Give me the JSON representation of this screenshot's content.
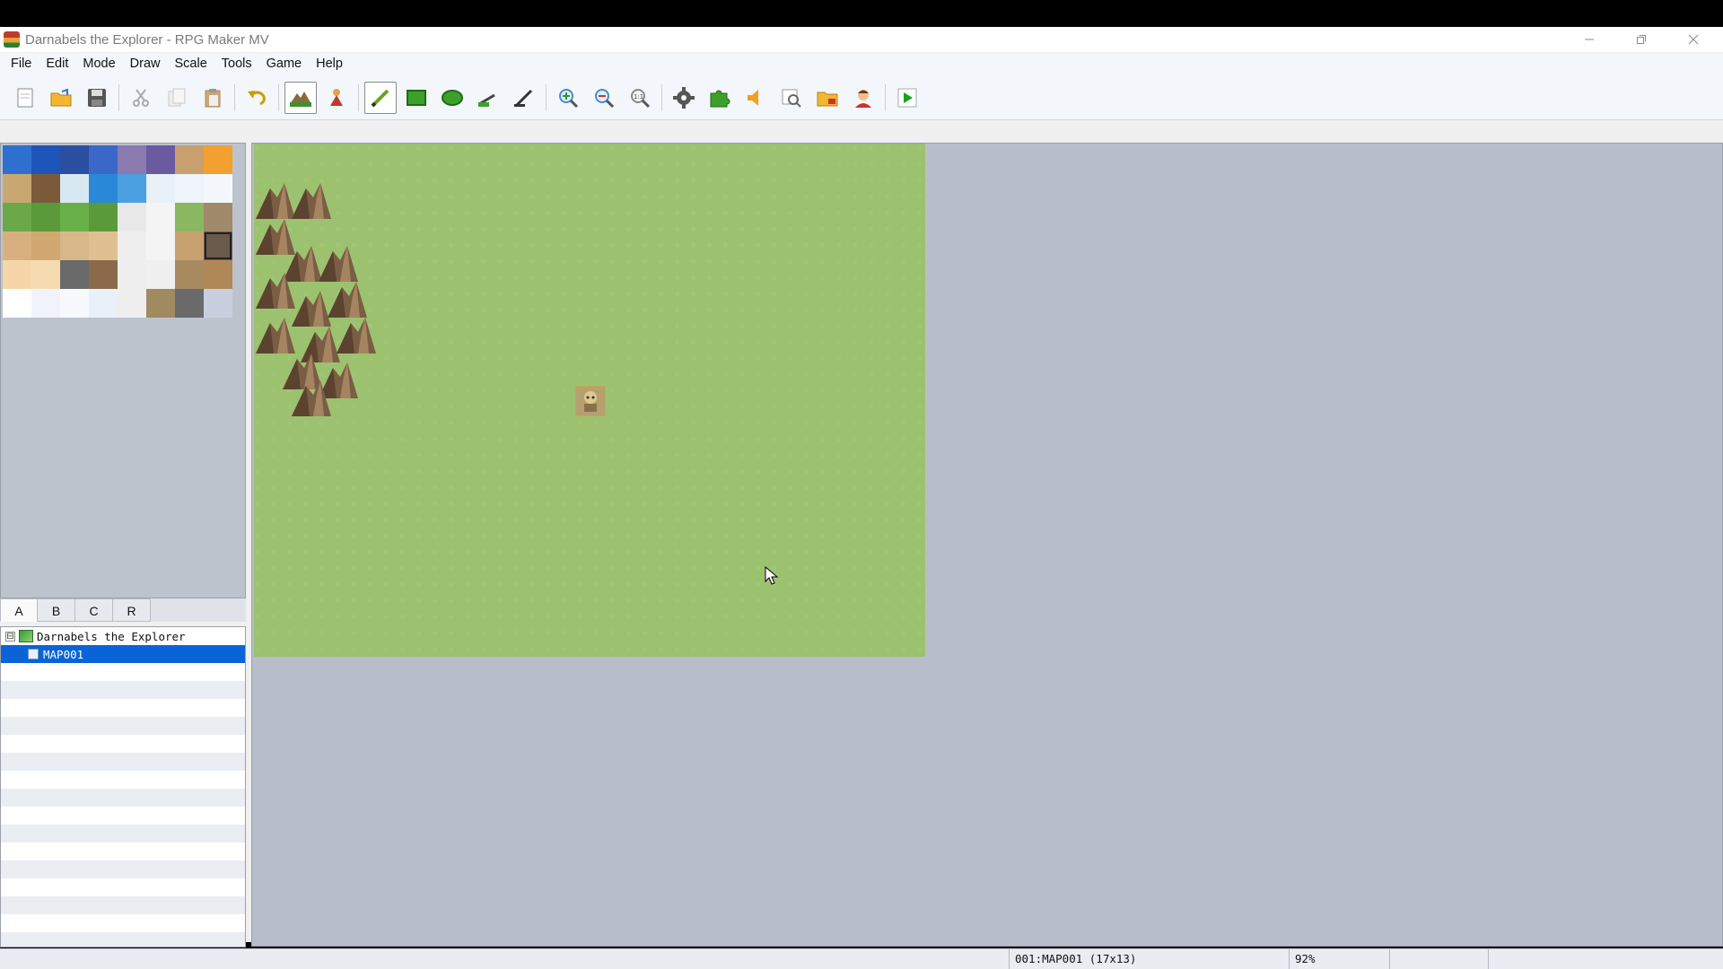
{
  "window": {
    "title": "Darnabels the Explorer - RPG Maker MV",
    "controls": [
      "minimize",
      "maximize",
      "close"
    ]
  },
  "menu": [
    "File",
    "Edit",
    "Mode",
    "Draw",
    "Scale",
    "Tools",
    "Game",
    "Help"
  ],
  "toolbar": {
    "groups": [
      [
        "new-project",
        "open-project",
        "save-project"
      ],
      [
        "cut",
        "copy",
        "paste"
      ],
      [
        "undo"
      ],
      [
        "map-mode",
        "event-mode"
      ],
      [
        "pencil",
        "rectangle",
        "ellipse",
        "fill",
        "shadow-pen"
      ],
      [
        "zoom-in",
        "zoom-out",
        "actual-size"
      ],
      [
        "database",
        "plugin-manager",
        "sound-test",
        "event-searcher",
        "resource-manager",
        "character-generator"
      ],
      [
        "playtest"
      ]
    ],
    "active": [
      "map-mode",
      "pencil"
    ]
  },
  "tileset_tabs": {
    "tabs": [
      "A",
      "B",
      "C",
      "R"
    ],
    "active": "A"
  },
  "map_tree": {
    "project": "Darnabels the Explorer",
    "expander": "⊟",
    "maps": [
      {
        "label": "MAP001",
        "selected": true
      }
    ]
  },
  "map": {
    "event_icon": "character-sprite-icon"
  },
  "status": {
    "map_info": "001:MAP001 (17x13)",
    "zoom": "92%"
  },
  "colors": {
    "grass": "#9cc26f",
    "selection": "#0a64d8",
    "viewport_bg": "#b8bec9"
  }
}
